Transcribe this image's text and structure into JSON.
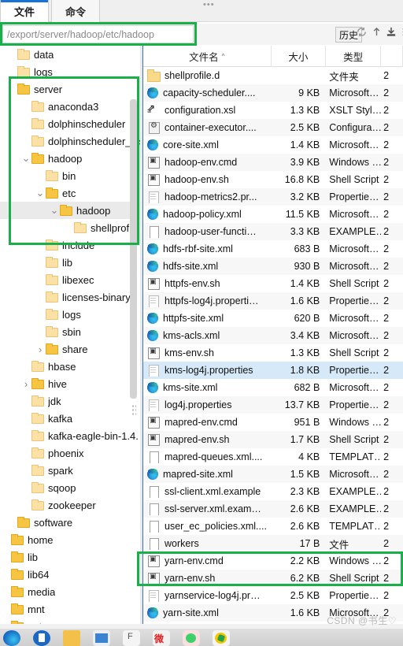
{
  "window": {
    "dots": "•••",
    "tabs": [
      {
        "label": "文件",
        "active": true
      },
      {
        "label": "命令",
        "active": false
      }
    ]
  },
  "address": {
    "value": "/export/server/hadoop/etc/hadoop",
    "placeholder": "/export/server/hadoop/etc/hadoop",
    "history_label": "历史",
    "icons": [
      "refresh-icon",
      "upload-icon",
      "download-icon",
      "more-icon"
    ]
  },
  "tree": {
    "items": [
      {
        "label": "data",
        "indent": 0,
        "chev": "",
        "open": false
      },
      {
        "label": "logs",
        "indent": 0,
        "chev": "",
        "open": false
      },
      {
        "label": "server",
        "indent": 0,
        "chev": "",
        "open": true
      },
      {
        "label": "anaconda3",
        "indent": 1,
        "chev": "",
        "open": false
      },
      {
        "label": "dolphinscheduler",
        "indent": 1,
        "chev": "",
        "open": false
      },
      {
        "label": "dolphinscheduler_ins",
        "indent": 1,
        "chev": "",
        "open": false
      },
      {
        "label": "hadoop",
        "indent": 1,
        "chev": "down",
        "open": true
      },
      {
        "label": "bin",
        "indent": 2,
        "chev": "",
        "open": false
      },
      {
        "label": "etc",
        "indent": 2,
        "chev": "down",
        "open": true
      },
      {
        "label": "hadoop",
        "indent": 3,
        "chev": "down",
        "open": true,
        "selected": true
      },
      {
        "label": "shellprofile.d",
        "indent": 4,
        "chev": "",
        "open": false
      },
      {
        "label": "include",
        "indent": 2,
        "chev": "",
        "open": false
      },
      {
        "label": "lib",
        "indent": 2,
        "chev": "",
        "open": false
      },
      {
        "label": "libexec",
        "indent": 2,
        "chev": "",
        "open": false
      },
      {
        "label": "licenses-binary",
        "indent": 2,
        "chev": "",
        "open": false
      },
      {
        "label": "logs",
        "indent": 2,
        "chev": "",
        "open": false
      },
      {
        "label": "sbin",
        "indent": 2,
        "chev": "",
        "open": false
      },
      {
        "label": "share",
        "indent": 2,
        "chev": "right",
        "open": true
      },
      {
        "label": "hbase",
        "indent": 1,
        "chev": "",
        "open": false
      },
      {
        "label": "hive",
        "indent": 1,
        "chev": "right",
        "open": true
      },
      {
        "label": "jdk",
        "indent": 1,
        "chev": "",
        "open": false
      },
      {
        "label": "kafka",
        "indent": 1,
        "chev": "",
        "open": false
      },
      {
        "label": "kafka-eagle-bin-1.4.",
        "indent": 1,
        "chev": "",
        "open": false
      },
      {
        "label": "phoenix",
        "indent": 1,
        "chev": "",
        "open": false
      },
      {
        "label": "spark",
        "indent": 1,
        "chev": "",
        "open": false
      },
      {
        "label": "sqoop",
        "indent": 1,
        "chev": "",
        "open": false
      },
      {
        "label": "zookeeper",
        "indent": 1,
        "chev": "",
        "open": false
      },
      {
        "label": "software",
        "indent": 0,
        "chev": "",
        "open": true
      },
      {
        "label": "home",
        "indent": -1,
        "chev": "",
        "open": true
      },
      {
        "label": "lib",
        "indent": -1,
        "chev": "",
        "open": true
      },
      {
        "label": "lib64",
        "indent": -1,
        "chev": "",
        "open": true
      },
      {
        "label": "media",
        "indent": -1,
        "chev": "",
        "open": true
      },
      {
        "label": "mnt",
        "indent": -1,
        "chev": "",
        "open": true
      },
      {
        "label": "opt",
        "indent": -1,
        "chev": "",
        "open": true
      }
    ]
  },
  "filelist": {
    "columns": {
      "name": "文件名",
      "sort": "^",
      "size": "大小",
      "type": "类型",
      "date": "2"
    },
    "rows": [
      {
        "icon": "folder-ic",
        "name": "shellprofile.d",
        "size": "",
        "type": "文件夹",
        "date": "2"
      },
      {
        "icon": "edge-ic",
        "name": "capacity-scheduler....",
        "size": "9 KB",
        "type": "Microsoft…",
        "date": "2"
      },
      {
        "icon": "xsl-ic",
        "name": "configuration.xsl",
        "size": "1.3 KB",
        "type": "XSLT Styl…",
        "date": "2"
      },
      {
        "icon": "cfg-ic",
        "name": "container-executor....",
        "size": "2.5 KB",
        "type": "Configura…",
        "date": "2"
      },
      {
        "icon": "edge-ic",
        "name": "core-site.xml",
        "size": "1.4 KB",
        "type": "Microsoft…",
        "date": "2"
      },
      {
        "icon": "sh-ic",
        "name": "hadoop-env.cmd",
        "size": "3.9 KB",
        "type": "Windows …",
        "date": "2"
      },
      {
        "icon": "sh-ic",
        "name": "hadoop-env.sh",
        "size": "16.8 KB",
        "type": "Shell Script",
        "date": "2"
      },
      {
        "icon": "doc-ic",
        "name": "hadoop-metrics2.pr...",
        "size": "3.2 KB",
        "type": "Propertie…",
        "date": "2"
      },
      {
        "icon": "edge-ic",
        "name": "hadoop-policy.xml",
        "size": "11.5 KB",
        "type": "Microsoft…",
        "date": "2"
      },
      {
        "icon": "blank-ic",
        "name": "hadoop-user-functi…",
        "size": "3.3 KB",
        "type": "EXAMPLE…",
        "date": "2"
      },
      {
        "icon": "edge-ic",
        "name": "hdfs-rbf-site.xml",
        "size": "683 B",
        "type": "Microsoft…",
        "date": "2"
      },
      {
        "icon": "edge-ic",
        "name": "hdfs-site.xml",
        "size": "930 B",
        "type": "Microsoft…",
        "date": "2"
      },
      {
        "icon": "sh-ic",
        "name": "httpfs-env.sh",
        "size": "1.4 KB",
        "type": "Shell Script",
        "date": "2"
      },
      {
        "icon": "doc-ic",
        "name": "httpfs-log4j.properti…",
        "size": "1.6 KB",
        "type": "Propertie…",
        "date": "2"
      },
      {
        "icon": "edge-ic",
        "name": "httpfs-site.xml",
        "size": "620 B",
        "type": "Microsoft…",
        "date": "2"
      },
      {
        "icon": "edge-ic",
        "name": "kms-acls.xml",
        "size": "3.4 KB",
        "type": "Microsoft…",
        "date": "2"
      },
      {
        "icon": "sh-ic",
        "name": "kms-env.sh",
        "size": "1.3 KB",
        "type": "Shell Script",
        "date": "2"
      },
      {
        "icon": "doc-ic",
        "name": "kms-log4j.properties",
        "size": "1.8 KB",
        "type": "Propertie…",
        "date": "2",
        "highlight": true
      },
      {
        "icon": "edge-ic",
        "name": "kms-site.xml",
        "size": "682 B",
        "type": "Microsoft…",
        "date": "2"
      },
      {
        "icon": "doc-ic",
        "name": "log4j.properties",
        "size": "13.7 KB",
        "type": "Propertie…",
        "date": "2"
      },
      {
        "icon": "sh-ic",
        "name": "mapred-env.cmd",
        "size": "951 B",
        "type": "Windows …",
        "date": "2"
      },
      {
        "icon": "sh-ic",
        "name": "mapred-env.sh",
        "size": "1.7 KB",
        "type": "Shell Script",
        "date": "2"
      },
      {
        "icon": "blank-ic",
        "name": "mapred-queues.xml....",
        "size": "4 KB",
        "type": "TEMPLAT…",
        "date": "2"
      },
      {
        "icon": "edge-ic",
        "name": "mapred-site.xml",
        "size": "1.5 KB",
        "type": "Microsoft…",
        "date": "2"
      },
      {
        "icon": "blank-ic",
        "name": "ssl-client.xml.example",
        "size": "2.3 KB",
        "type": "EXAMPLE…",
        "date": "2"
      },
      {
        "icon": "blank-ic",
        "name": "ssl-server.xml.exam…",
        "size": "2.6 KB",
        "type": "EXAMPLE…",
        "date": "2"
      },
      {
        "icon": "blank-ic",
        "name": "user_ec_policies.xml....",
        "size": "2.6 KB",
        "type": "TEMPLAT…",
        "date": "2"
      },
      {
        "icon": "blank-ic",
        "name": "workers",
        "size": "17 B",
        "type": "文件",
        "date": "2"
      },
      {
        "icon": "sh-ic",
        "name": "yarn-env.cmd",
        "size": "2.2 KB",
        "type": "Windows …",
        "date": "2"
      },
      {
        "icon": "sh-ic",
        "name": "yarn-env.sh",
        "size": "6.2 KB",
        "type": "Shell Script",
        "date": "2"
      },
      {
        "icon": "doc-ic",
        "name": "yarnservice-log4j.pr…",
        "size": "2.5 KB",
        "type": "Propertie…",
        "date": "2"
      },
      {
        "icon": "edge-ic",
        "name": "yarn-site.xml",
        "size": "1.6 KB",
        "type": "Microsoft…",
        "date": "2"
      }
    ]
  },
  "watermark": {
    "text": "CSDN @书生♡"
  },
  "annotations": {
    "color": "#19b04a"
  }
}
